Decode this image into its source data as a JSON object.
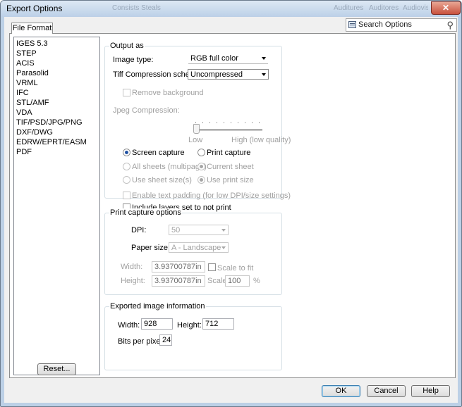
{
  "window": {
    "title": "Export Options",
    "ghost_titles": [
      "Consists Steals",
      "Auditures",
      "Auditores",
      "Audiovisuals"
    ],
    "close_label": "✕"
  },
  "tabs": [
    {
      "label": "File Format",
      "active": true
    }
  ],
  "search": {
    "placeholder": "Search Options",
    "icon": "search-icon"
  },
  "formats": [
    "IGES 5.3",
    "STEP",
    "ACIS",
    "Parasolid",
    "VRML",
    "IFC",
    "STL/AMF",
    "VDA",
    "TIF/PSD/JPG/PNG",
    "DXF/DWG",
    "EDRW/EPRT/EASM",
    "PDF"
  ],
  "output_as": {
    "legend": "Output as",
    "image_type_label": "Image type:",
    "image_type_value": "RGB full color",
    "tiff_label": "Tiff Compression scheme:",
    "tiff_value": "Uncompressed",
    "remove_background": {
      "label": "Remove background",
      "checked": false,
      "enabled": false
    },
    "jpeg_label": "Jpeg Compression:",
    "jpeg_low": "Low",
    "jpeg_high": "High (low quality)",
    "jpeg_level": 0,
    "screen_capture": {
      "label": "Screen capture",
      "selected": true
    },
    "print_capture": {
      "label": "Print capture",
      "selected": false
    },
    "all_sheets": {
      "label": "All sheets (multipage)",
      "selected": false
    },
    "current_sheet": {
      "label": "Current sheet",
      "selected": true
    },
    "use_sheet_size": {
      "label": "Use sheet size(s)",
      "selected": false
    },
    "use_print_size": {
      "label": "Use print size",
      "selected": true
    },
    "enable_text_padding": {
      "label": "Enable text padding (for low DPI/size settings)",
      "checked": false,
      "enabled": false
    },
    "include_layers": {
      "label": "Include layers set to not print",
      "checked": false,
      "enabled": true
    }
  },
  "print_capture": {
    "legend": "Print capture options",
    "dpi_label": "DPI:",
    "dpi_value": "50",
    "paper_size_label": "Paper size:",
    "paper_size_value": "A - Landscape",
    "width_label": "Width:",
    "width_value": "3.93700787in",
    "scale_to_fit": {
      "label": "Scale to fit",
      "checked": false
    },
    "height_label": "Height:",
    "height_value": "3.93700787in",
    "scale_label": "Scale:",
    "scale_value": "100",
    "scale_unit": "%"
  },
  "exported_info": {
    "legend": "Exported image information",
    "width_label": "Width:",
    "width_value": "928",
    "height_label": "Height:",
    "height_value": "712",
    "bpp_label": "Bits per pixel:",
    "bpp_value": "24"
  },
  "buttons": {
    "reset": "Reset...",
    "ok": "OK",
    "cancel": "Cancel",
    "help": "Help"
  }
}
